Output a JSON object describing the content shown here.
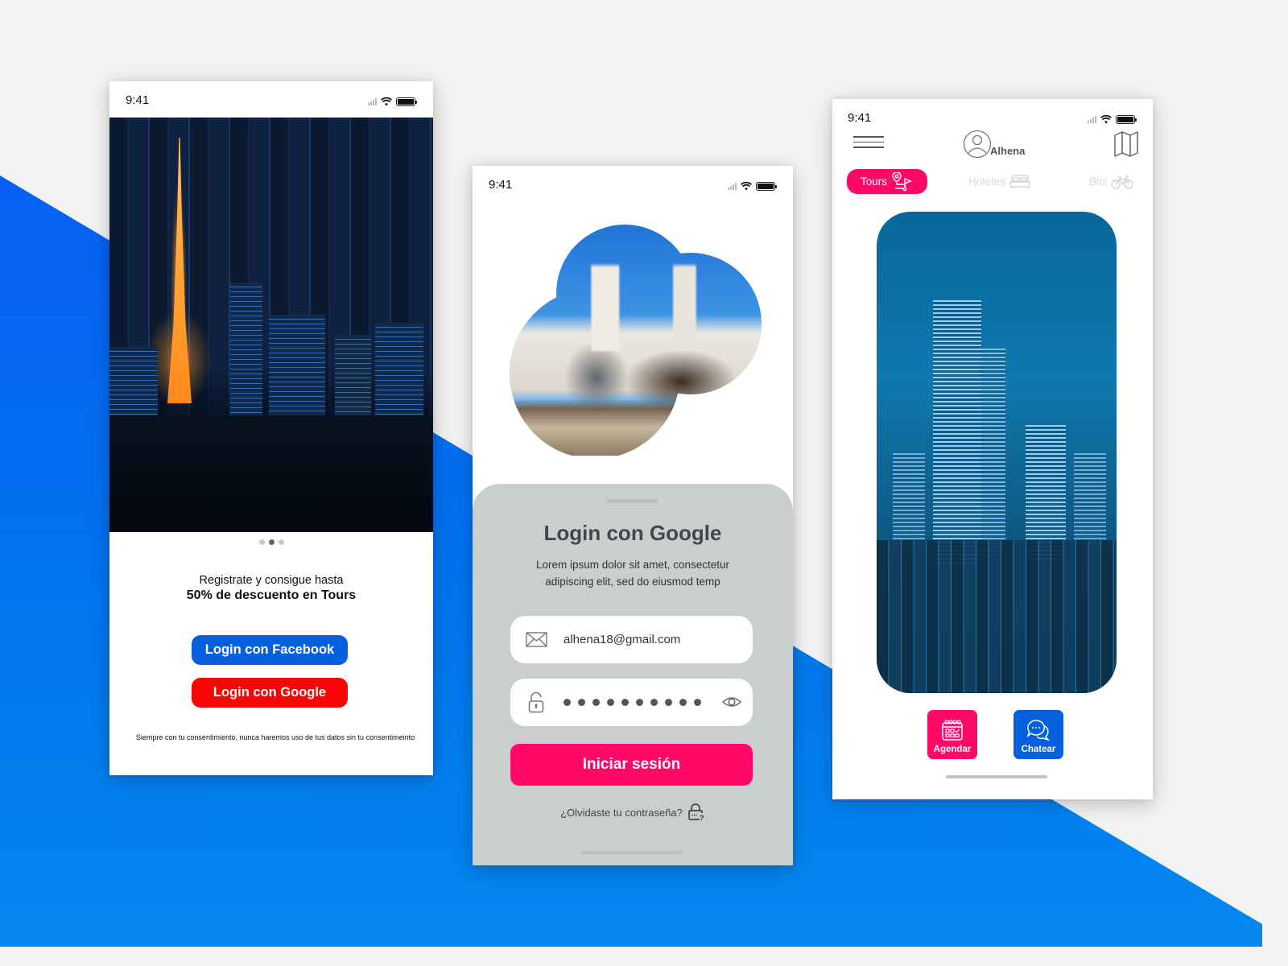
{
  "background": {
    "top_color": "#f3f3f3",
    "bottom_color": "#0a57f5"
  },
  "colors": {
    "facebook_blue": "#0560dd",
    "google_red": "#fa0505",
    "accent_pink": "#ff0868",
    "sheet_gray": "#cbcecf"
  },
  "onboarding_screen": {
    "status_time": "9:41",
    "carousel": {
      "total": 3,
      "active_index": 2
    },
    "promo_line1": "Registrate y consigue hasta",
    "promo_line2": "50% de descuento en Tours",
    "facebook_button": "Login con Facebook",
    "google_button": "Login con Google",
    "consent_text": "Siempre con tu consentimiento, nunca haremos uso de tus datos sin tu consentimeinto"
  },
  "login_screen": {
    "status_time": "9:41",
    "title": "Login con Google",
    "description_line1": "Lorem ipsum dolor sit amet, consectetur",
    "description_line2": "adipiscing elit, sed do eiusmod temp",
    "email_value": "alhena18@gmail.com",
    "password_masked_length": 10,
    "submit_button": "Iniciar sesión",
    "forgot_password": "¿Olvidaste tu contraseña?",
    "icons": [
      "mail-icon",
      "unlock-icon",
      "eye-icon",
      "lock-question-icon"
    ]
  },
  "home_screen": {
    "status_time": "9:41",
    "user_name": "Alhena",
    "tabs": [
      {
        "label": "Tours",
        "icon": "route-pin-flag-icon",
        "active": true
      },
      {
        "label": "Hoteles",
        "icon": "bed-icon",
        "active": false
      },
      {
        "label": "Bici",
        "icon": "bicycle-icon",
        "active": false
      }
    ],
    "actions": [
      {
        "label": "Agendar",
        "icon": "calendar-icon"
      },
      {
        "label": "Chatear",
        "icon": "chat-bubbles-icon"
      }
    ]
  }
}
